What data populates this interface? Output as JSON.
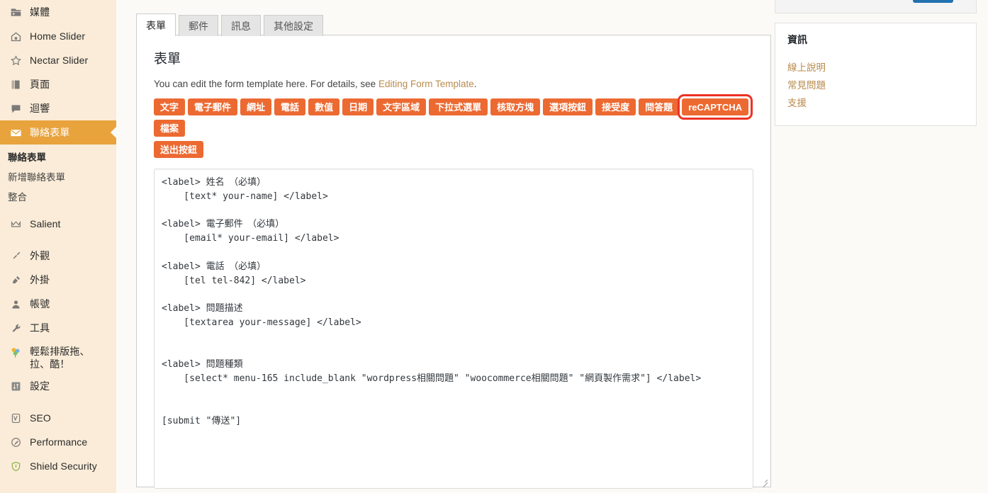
{
  "sidebar": {
    "items": [
      {
        "label": "媒體",
        "icon": "media-icon",
        "current": false
      },
      {
        "label": "Home Slider",
        "icon": "home-icon",
        "current": false
      },
      {
        "label": "Nectar Slider",
        "icon": "star-icon",
        "current": false
      },
      {
        "label": "頁面",
        "icon": "pages-icon",
        "current": false
      },
      {
        "label": "迴響",
        "icon": "comments-icon",
        "current": false
      },
      {
        "label": "聯絡表單",
        "icon": "envelope-icon",
        "current": true
      }
    ],
    "submenu": [
      {
        "label": "聯絡表單",
        "current": true
      },
      {
        "label": "新增聯絡表單",
        "current": false
      },
      {
        "label": "整合",
        "current": false
      }
    ],
    "items2": [
      {
        "label": "Salient",
        "icon": "crown-icon"
      }
    ],
    "items3": [
      {
        "label": "外觀",
        "icon": "appearance-brush-icon"
      },
      {
        "label": "外掛",
        "icon": "plugin-plug-icon"
      },
      {
        "label": "帳號",
        "icon": "users-icon"
      },
      {
        "label": "工具",
        "icon": "tools-wrench-icon"
      },
      {
        "label": "輕鬆排版拖、拉、酷！",
        "icon": "balloons-icon"
      },
      {
        "label": "設定",
        "icon": "settings-sliders-icon"
      }
    ],
    "items4": [
      {
        "label": "SEO",
        "icon": "yoast-seo-icon"
      },
      {
        "label": "Performance",
        "icon": "performance-icon"
      },
      {
        "label": "Shield Security",
        "icon": "shield-icon"
      }
    ],
    "accent_color": "#e8a33d",
    "background_color": "#faecd8"
  },
  "tabs": [
    {
      "label": "表單",
      "active": true
    },
    {
      "label": "郵件",
      "active": false
    },
    {
      "label": "訊息",
      "active": false
    },
    {
      "label": "其他設定",
      "active": false
    }
  ],
  "panel": {
    "title": "表單",
    "description_prefix": "You can edit the form template here. For details, see ",
    "description_link": "Editing Form Template",
    "description_suffix": "."
  },
  "tag_generator": {
    "accent_color": "#ec6a32",
    "highlight_color": "#ee3124",
    "row1": [
      {
        "label": "文字",
        "highlighted": false
      },
      {
        "label": "電子郵件",
        "highlighted": false
      },
      {
        "label": "網址",
        "highlighted": false
      },
      {
        "label": "電話",
        "highlighted": false
      },
      {
        "label": "數值",
        "highlighted": false
      },
      {
        "label": "日期",
        "highlighted": false
      },
      {
        "label": "文字區域",
        "highlighted": false
      },
      {
        "label": "下拉式選單",
        "highlighted": false
      },
      {
        "label": "核取方塊",
        "highlighted": false
      },
      {
        "label": "選項按鈕",
        "highlighted": false
      },
      {
        "label": "接受度",
        "highlighted": false
      },
      {
        "label": "問答題",
        "highlighted": false
      },
      {
        "label": "reCAPTCHA",
        "highlighted": true
      },
      {
        "label": "檔案",
        "highlighted": false
      }
    ],
    "row2": [
      {
        "label": "送出按鈕",
        "highlighted": false
      }
    ]
  },
  "form_template": {
    "value": "<label> 姓名　（必填）\n    [text* your-name] </label>\n\n<label> 電子郵件　（必填）\n    [email* your-email] </label>\n\n<label> 電話　（必填）\n    [tel tel-842] </label>\n\n<label> 問題描述\n    [textarea your-message] </label>\n\n\n<label> 問題種類\n    [select* menu-165 include_blank \"wordpress相關問題\" \"woocommerce相關問題\" \"網頁製作需求\"] </label>\n\n\n[submit \"傳送\"]"
  },
  "right_column": {
    "info": {
      "title": "資訊",
      "links": [
        {
          "label": "線上說明"
        },
        {
          "label": "常見問題"
        },
        {
          "label": "支援"
        }
      ]
    }
  }
}
